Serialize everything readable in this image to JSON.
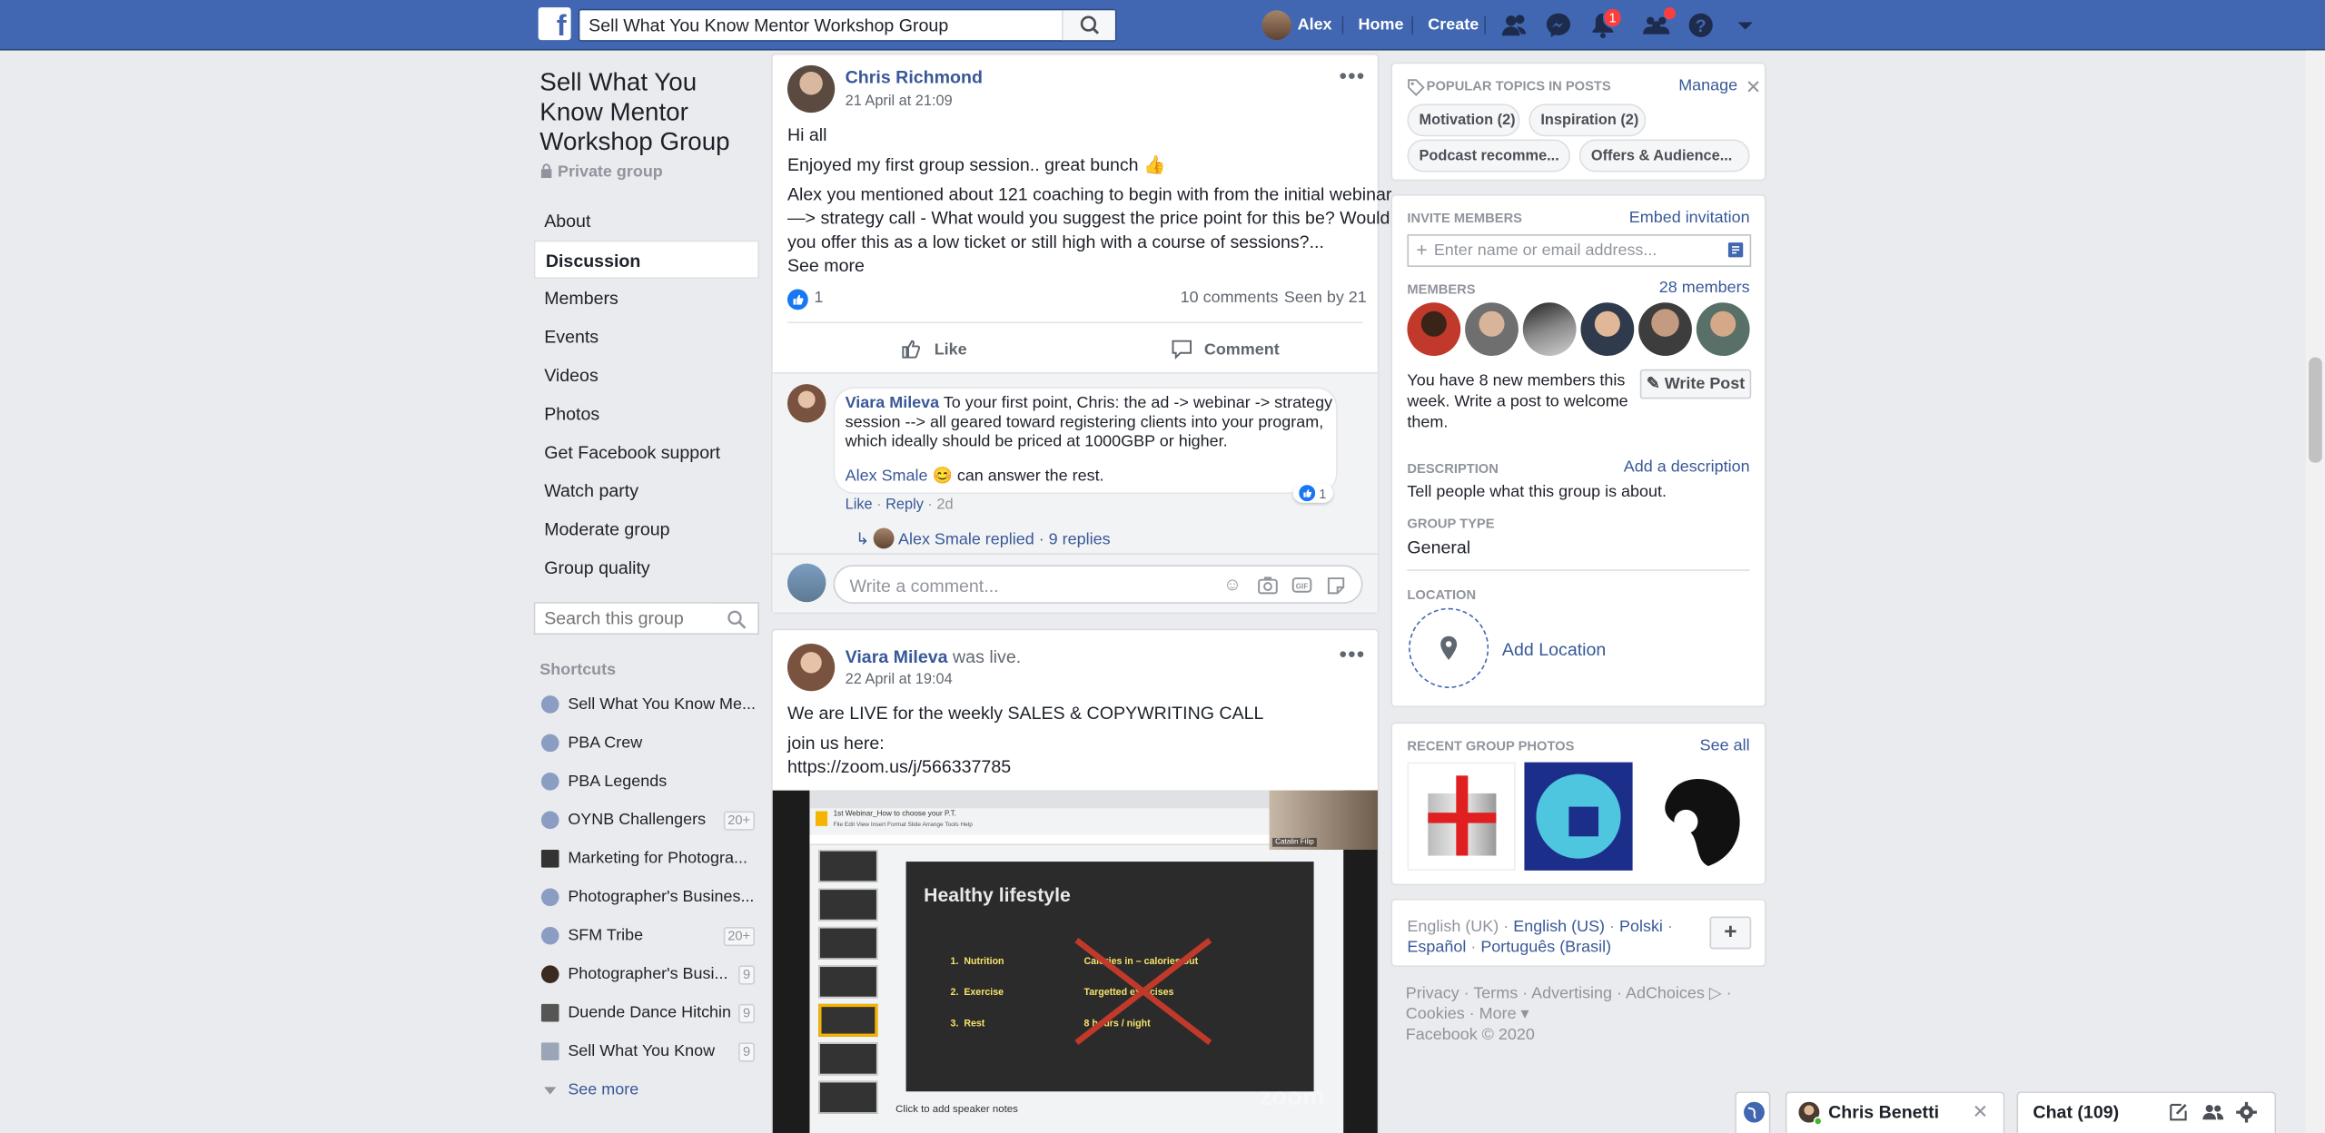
{
  "topbar": {
    "search_value": "Sell What You Know Mentor Workshop Group",
    "user_name": "Alex",
    "home": "Home",
    "create": "Create",
    "notif_count": "1"
  },
  "group": {
    "title_line1": "Sell What You",
    "title_line2": "Know Mentor",
    "title_line3": "Workshop Group",
    "privacy": "Private group",
    "menu": [
      "About",
      "Discussion",
      "Members",
      "Events",
      "Videos",
      "Photos",
      "Get Facebook support",
      "Watch party",
      "Moderate group",
      "Group quality"
    ],
    "search_placeholder": "Search this group",
    "shortcuts_title": "Shortcuts",
    "shortcuts": [
      {
        "label": "Sell What You Know Me...",
        "count": ""
      },
      {
        "label": "PBA Crew",
        "count": ""
      },
      {
        "label": "PBA Legends",
        "count": ""
      },
      {
        "label": "OYNB Challengers",
        "count": "20+"
      },
      {
        "label": "Marketing for Photogra...",
        "count": ""
      },
      {
        "label": "Photographer's Busines...",
        "count": ""
      },
      {
        "label": "SFM Tribe",
        "count": "20+"
      },
      {
        "label": "Photographer's Busi...",
        "count": "9"
      },
      {
        "label": "Duende Dance Hitchin",
        "count": "9"
      },
      {
        "label": "Sell What You Know",
        "count": "9"
      }
    ],
    "see_more": "See more"
  },
  "post1": {
    "author": "Chris Richmond",
    "time": "21 April at 21:09",
    "line1": "Hi all",
    "line2": "Enjoyed my first group session.. great bunch 👍",
    "line3": "Alex you mentioned about 121 coaching to begin with from the initial webinar",
    "line4": "—> strategy call - What would you suggest the price point for this be? Would",
    "line5": "you offer this as a low ticket or still high with a course of sessions?...",
    "see_more": "See more",
    "likes": "1",
    "comments": "10 comments",
    "seen": "Seen by 21",
    "like_btn": "Like",
    "comment_btn": "Comment",
    "comment": {
      "author": "Viara Mileva",
      "text1": "To your first point, Chris: the ad -> webinar -> strategy",
      "text2": "session --> all geared toward registering clients into your program,",
      "text3": "which ideally should be priced at 1000GBP or higher.",
      "mention": "Alex Smale",
      "text4": "😊 can answer the rest.",
      "like": "Like",
      "reply": "Reply",
      "age": "2d",
      "reaction_count": "1",
      "replies": "Alex Smale replied · 9 replies"
    },
    "write_placeholder": "Write a comment..."
  },
  "post2": {
    "author": "Viara Mileva",
    "was_live": "was live.",
    "time": "22 April at 19:04",
    "line1": "We are LIVE for the weekly SALES & COPYWRITING CALL",
    "line2": "join us here:",
    "link": "https://zoom.us/j/566337785",
    "video": {
      "slide_title": "Healthy lifestyle",
      "items": [
        "Nutrition",
        "Exercise",
        "Rest"
      ],
      "crossed": [
        "Calories in – calories out",
        "Targetted exercises",
        "8 hours / night"
      ],
      "doc_title": "1st Webinar_How to choose your P.T.",
      "doc_menu": "File  Edit  View  Insert  Format  Slide  Arrange  Tools  Help",
      "speaker_notes": "Click to add speaker notes",
      "cam_name": "Catalin Filip",
      "zoom": "zoom"
    }
  },
  "right": {
    "topics_title": "POPULAR TOPICS IN POSTS",
    "manage": "Manage",
    "topics": [
      "Motivation (2)",
      "Inspiration (2)",
      "Podcast recomme...",
      "Offers & Audience..."
    ],
    "invite_title": "INVITE MEMBERS",
    "embed": "Embed invitation",
    "invite_placeholder": "Enter name or email address...",
    "members_title": "MEMBERS",
    "members_count": "28 members",
    "new_members_1": "You have 8 new members this",
    "new_members_2": "week. Write a post to welcome",
    "new_members_3": "them.",
    "write_post": "Write Post",
    "desc_title": "DESCRIPTION",
    "add_desc": "Add a description",
    "desc_text": "Tell people what this group is about.",
    "type_title": "GROUP TYPE",
    "type_value": "General",
    "location_title": "LOCATION",
    "add_location": "Add Location",
    "photos_title": "RECENT GROUP PHOTOS",
    "see_all": "See all",
    "lang_current": "English (UK) ·",
    "lang_links": [
      "English (US)",
      "Polski",
      "Español",
      "Português (Brasil)"
    ],
    "footer_1": "Privacy · Terms · Advertising · AdChoices ▷ ·",
    "footer_2": "Cookies · More ▾",
    "copyright": "Facebook © 2020"
  },
  "chat": {
    "contact": "Chris Benetti",
    "chat_label": "Chat (109)"
  },
  "colors": {
    "brand": "#4267b2",
    "link": "#385898",
    "bg": "#e9ebee"
  }
}
